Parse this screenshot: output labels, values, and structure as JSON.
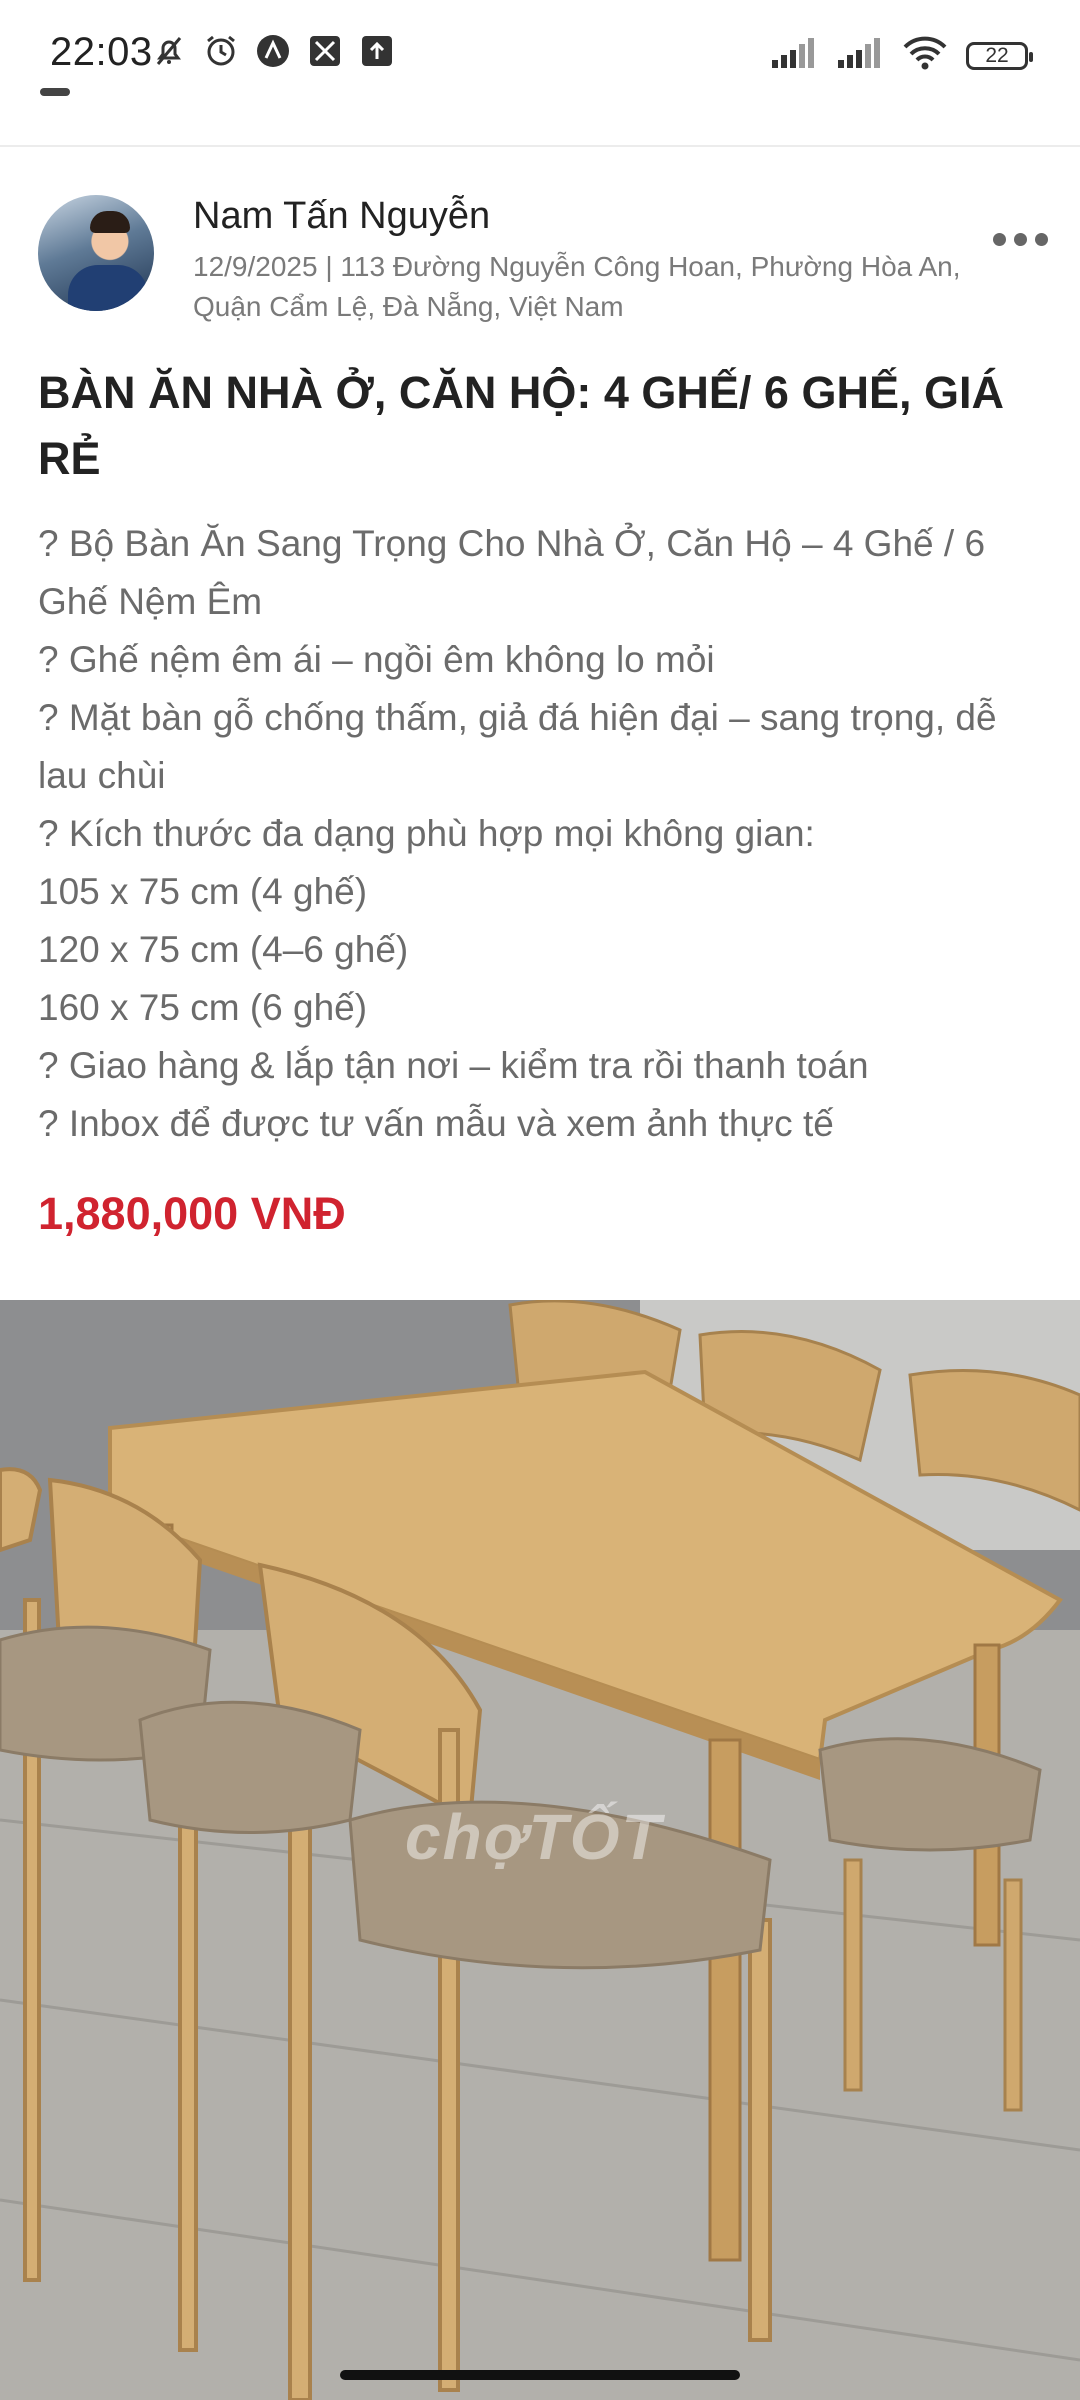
{
  "status_bar": {
    "time": "22:03",
    "battery": "22",
    "icons_left": [
      "mute-icon",
      "alarm-icon",
      "app-a-icon",
      "app-x-icon",
      "upload-icon"
    ],
    "icons_right": [
      "signal-icon",
      "signal-icon",
      "wifi-icon",
      "battery-icon"
    ]
  },
  "post": {
    "author_name": "Nam Tấn Nguyễn",
    "meta_line1": "12/9/2025 | 113 Đường Nguyễn Công Hoan, Phường Hòa An,",
    "meta_line2": "Quận Cẩm Lệ, Đà Nẵng, Việt Nam",
    "more_icon": "more-horizontal-icon"
  },
  "listing": {
    "title": "BÀN ĂN NHÀ Ở, CĂN HỘ: 4 GHẾ/ 6 GHẾ, GIÁ RẺ",
    "description": [
      "? Bộ Bàn Ăn Sang Trọng Cho Nhà Ở, Căn Hộ – 4 Ghế / 6 Ghế Nệm Êm",
      "? Ghế nệm êm ái – ngồi êm không lo mỏi",
      "? Mặt bàn gỗ chống thấm, giả đá hiện đại – sang trọng, dễ lau chùi",
      "? Kích thước đa dạng phù hợp mọi không gian:",
      "105 x 75 cm (4 ghế)",
      "120 x 75 cm (4–6 ghế)",
      "160 x 75 cm (6 ghế)",
      "? Giao hàng & lắp tận nơi – kiểm tra rồi thanh toán",
      "? Inbox để được tư vấn mẫu và xem ảnh thực tế"
    ],
    "price": "1,880,000 VNĐ",
    "photo_watermark": "chợTỐT"
  },
  "colors": {
    "price": "#d0232f",
    "text_primary": "#222222",
    "text_secondary": "#6b6b6b",
    "wood": "#d9b377"
  }
}
